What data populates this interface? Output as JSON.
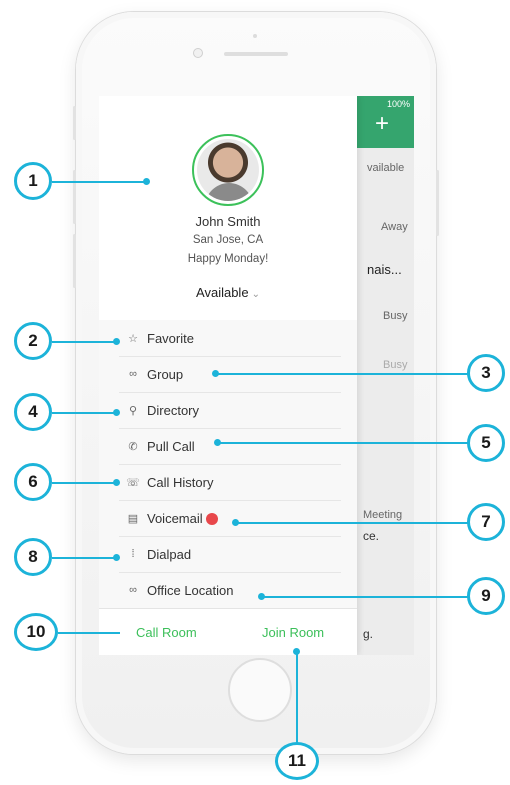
{
  "profile": {
    "name": "John Smith",
    "location": "San Jose, CA",
    "status_message": "Happy Monday!",
    "availability": "Available"
  },
  "menu": [
    {
      "label": "Favorite",
      "icon": "star-icon"
    },
    {
      "label": "Group",
      "icon": "group-icon"
    },
    {
      "label": "Directory",
      "icon": "search-icon"
    },
    {
      "label": "Pull Call",
      "icon": "phone-pull-icon"
    },
    {
      "label": "Call History",
      "icon": "call-history-icon"
    },
    {
      "label": "Voicemail",
      "icon": "voicemail-icon",
      "badge": true
    },
    {
      "label": "Dialpad",
      "icon": "dialpad-icon"
    },
    {
      "label": "Office Location",
      "icon": "link-icon"
    }
  ],
  "footer": {
    "call_room": "Call Room",
    "join_room": "Join Room"
  },
  "background_app": {
    "battery": "100%",
    "items": [
      "vailable",
      "Away",
      "nais...",
      "Busy",
      "Busy",
      "Meeting",
      "ce.",
      "g."
    ]
  },
  "callouts": [
    "1",
    "2",
    "3",
    "4",
    "5",
    "6",
    "7",
    "8",
    "9",
    "10",
    "11"
  ],
  "colors": {
    "accent_green": "#3cbf5a",
    "callout_blue": "#1cb3d9",
    "badge_red": "#e8474b",
    "header_green": "#35a56e"
  }
}
